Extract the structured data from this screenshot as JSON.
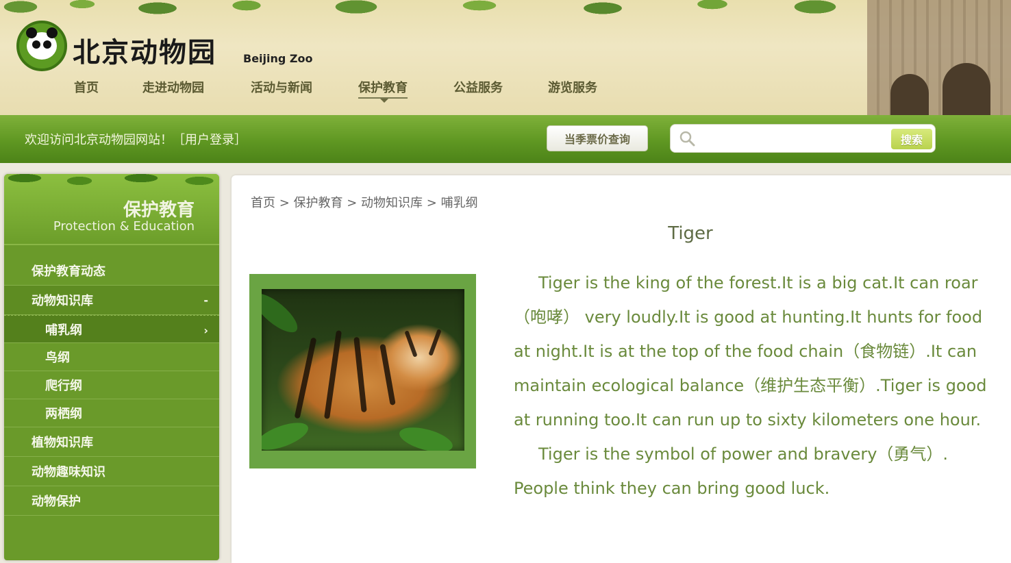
{
  "header": {
    "brand_cn": "北京动物园",
    "brand_en": "Beijing Zoo",
    "nav": [
      {
        "label": "首页"
      },
      {
        "label": "走进动物园"
      },
      {
        "label": "活动与新闻"
      },
      {
        "label": "保护教育",
        "active": true
      },
      {
        "label": "公益服务"
      },
      {
        "label": "游览服务"
      }
    ]
  },
  "toolbar": {
    "welcome": "欢迎访问北京动物园网站！［用户登录］",
    "ticket_button": "当季票价查询",
    "search_placeholder": "",
    "search_button": "搜索"
  },
  "sidebar": {
    "title_cn": "保护教育",
    "title_en": "Protection & Education",
    "items": [
      {
        "label": "保护教育动态"
      },
      {
        "label": "动物知识库",
        "marker": "-"
      },
      {
        "label": "哺乳纲",
        "marker": "›"
      },
      {
        "label": "鸟纲"
      },
      {
        "label": "爬行纲"
      },
      {
        "label": "两栖纲"
      },
      {
        "label": "植物知识库"
      },
      {
        "label": "动物趣味知识"
      },
      {
        "label": "动物保护"
      }
    ]
  },
  "content": {
    "breadcrumb": "首页 > 保护教育 > 动物知识库 > 哺乳纲",
    "title": "Tiger",
    "paragraphs": [
      "Tiger is the king of the forest.It is a big cat.It can roar（咆哮） very loudly.It is good at hunting.It hunts for food at night.It is at the top of the food chain（食物链）.It can maintain ecological balance（维护生态平衡）.Tiger is good at running too.It can run up to sixty kilometers one hour.",
      "Tiger is the symbol of power and bravery（勇气）. People think they can bring good luck."
    ]
  },
  "colors": {
    "accent_green": "#5f9722",
    "sidebar_green": "#6a9a2a",
    "body_text": "#6a8a3c"
  }
}
